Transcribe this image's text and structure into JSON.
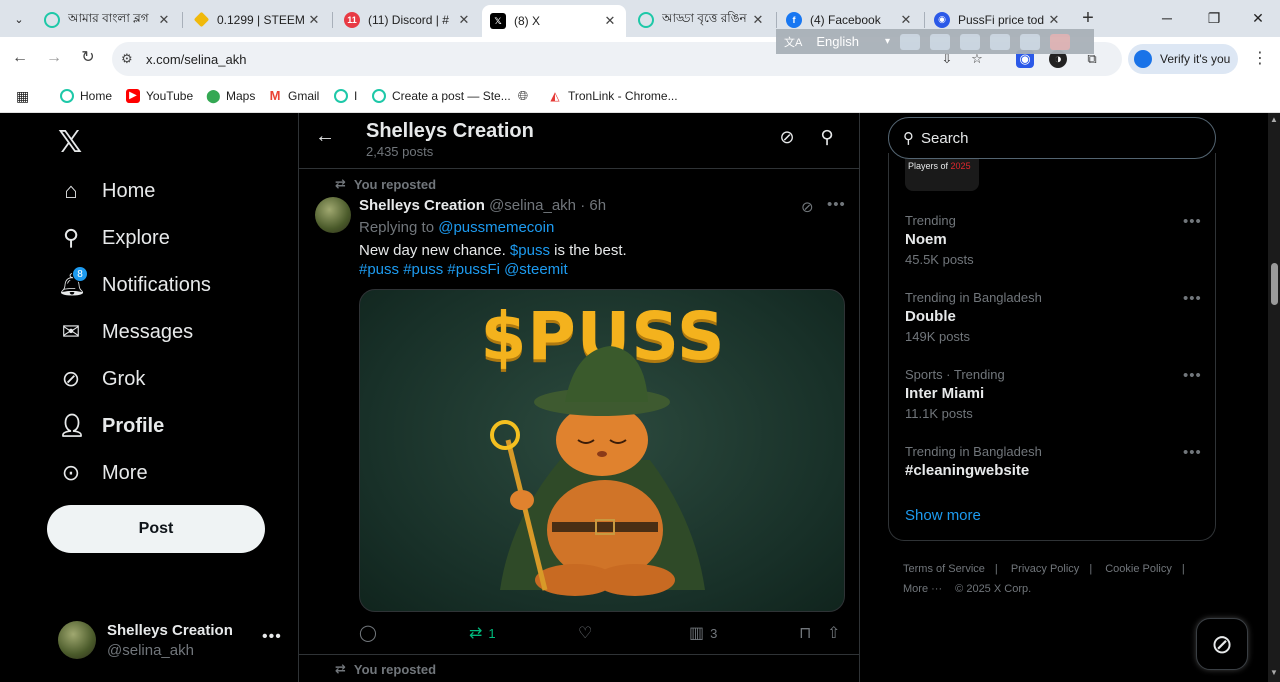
{
  "browser": {
    "tabs": [
      {
        "title": "আমার বাংলা ব্লগ",
        "favicon": "steemit-icon",
        "active": false
      },
      {
        "title": "0.1299 | STEEM",
        "favicon": "binance-icon",
        "active": false
      },
      {
        "title": "(11) Discord | #",
        "favicon": "discord-icon",
        "active": false
      },
      {
        "title": "(8) X",
        "favicon": "x-icon",
        "active": true
      },
      {
        "title": "আড্ডা বৃত্তে রঙিন",
        "favicon": "steemit-icon",
        "active": false
      },
      {
        "title": "(4) Facebook",
        "favicon": "facebook-icon",
        "active": false
      },
      {
        "title": "PussFi price tod",
        "favicon": "pussfi-icon",
        "active": false
      }
    ],
    "url": "x.com/selina_akh",
    "translate_language": "English",
    "verify_label": "Verify it's you",
    "bookmarks": [
      {
        "label": "Home",
        "icon": "steemit-icon"
      },
      {
        "label": "YouTube",
        "icon": "youtube-icon"
      },
      {
        "label": "Maps",
        "icon": "maps-icon"
      },
      {
        "label": "Gmail",
        "icon": "gmail-icon"
      },
      {
        "label": "I",
        "icon": "steemit-icon"
      },
      {
        "label": "Create a post — Ste...",
        "icon": "steemit-icon"
      },
      {
        "label": "",
        "icon": "globe-icon"
      },
      {
        "label": "TronLink - Chrome...",
        "icon": "tronlink-icon"
      }
    ]
  },
  "nav": {
    "items": [
      {
        "label": "Home",
        "icon": "home-icon"
      },
      {
        "label": "Explore",
        "icon": "search-icon"
      },
      {
        "label": "Notifications",
        "icon": "bell-icon",
        "badge": "8"
      },
      {
        "label": "Messages",
        "icon": "mail-icon"
      },
      {
        "label": "Grok",
        "icon": "grok-icon"
      },
      {
        "label": "Profile",
        "icon": "person-icon"
      },
      {
        "label": "More",
        "icon": "more-circle-icon"
      }
    ],
    "post_label": "Post",
    "account": {
      "name": "Shelleys Creation",
      "handle": "@selina_akh"
    }
  },
  "profile_header": {
    "title": "Shelleys Creation",
    "post_count": "2,435 posts"
  },
  "tweet": {
    "repost_label": "You reposted",
    "author": "Shelleys Creation",
    "handle": "@selina_akh",
    "time": "6h",
    "replying_to_label": "Replying to",
    "replying_to": "@pussmemecoin",
    "text_before": "New day new chance. ",
    "cashtag": "$puss",
    "text_after": " is the best.",
    "hashtags": "#puss #puss #pussFi @steemit",
    "media_text": "$PUSS",
    "retweets": "1",
    "views": "3"
  },
  "next_tweet": {
    "repost_label": "You reposted"
  },
  "sidebar": {
    "search_placeholder": "Search",
    "partial_card": {
      "text": "Players of",
      "year": "2025"
    },
    "trends": [
      {
        "context": "Trending",
        "name": "Noem",
        "count": "45.5K posts"
      },
      {
        "context": "Trending in Bangladesh",
        "name": "Double",
        "count": "149K posts"
      },
      {
        "context": "Sports · Trending",
        "name": "Inter Miami",
        "count": "11.1K posts"
      },
      {
        "context": "Trending in Bangladesh",
        "name": "#cleaningwebsite",
        "count": ""
      }
    ],
    "show_more": "Show more",
    "footer": {
      "terms": "Terms of Service",
      "privacy": "Privacy Policy",
      "cookie": "Cookie Policy",
      "more": "More ···",
      "copyright": "© 2025 X Corp."
    }
  },
  "colors": {
    "accent": "#1d9bf0",
    "retweet": "#00ba7c",
    "puss_gold": "#f4b21d"
  }
}
